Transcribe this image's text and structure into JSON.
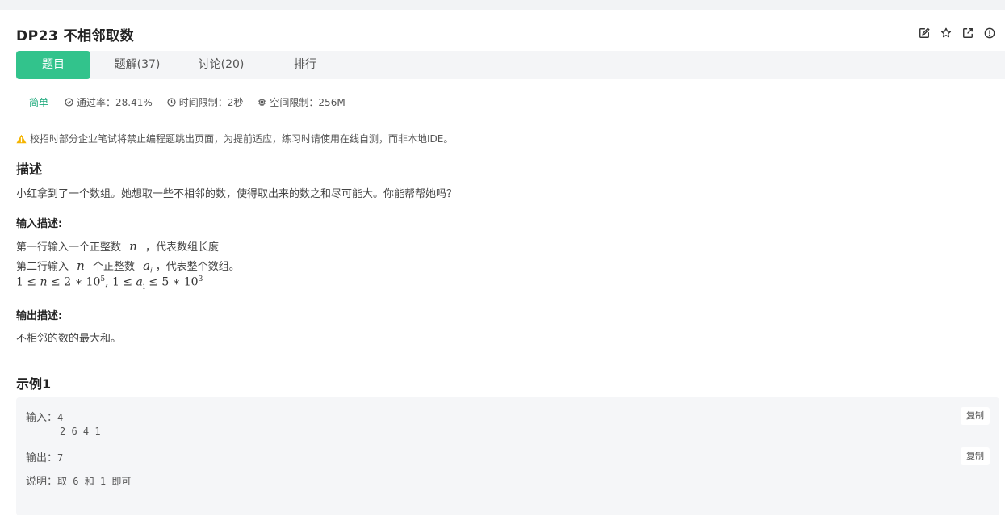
{
  "problem": {
    "title": "DP23  不相邻取数",
    "difficulty": "简单",
    "pass_rate": "通过率：28.41%",
    "time_limit": "时间限制：2秒",
    "space_limit": "空间限制：256M"
  },
  "tabs": [
    {
      "label": "题目",
      "active": true
    },
    {
      "label": "题解(37)"
    },
    {
      "label": "讨论(20)"
    },
    {
      "label": "排行"
    }
  ],
  "top_icons": [
    "edit-icon",
    "star-icon",
    "external-link-icon",
    "info-icon"
  ],
  "warning": "校招时部分企业笔试将禁止编程题跳出页面，为提前适应，练习时请使用在线自测，而非本地IDE。",
  "description": {
    "heading": "描述",
    "text": "小红拿到了一个数组。她想取一些不相邻的数，使得取出来的数之和尽可能大。你能帮帮她吗？"
  },
  "input_desc": {
    "heading": "输入描述:",
    "line1_a": "第一行输入一个正整数",
    "line1_var": "n",
    "line1_b": "，代表数组长度",
    "line2_a": "第二行输入",
    "line2_var": "n",
    "line2_b": "个正整数",
    "line2_var2": "a",
    "line2_sub": "i",
    "line2_c": "，代表整个数组。",
    "constraint_a": "1 ≤ ",
    "constraint_n": "n",
    "constraint_b": " ≤ 2 ∗ 10",
    "constraint_exp1": "5",
    "constraint_c": ", 1 ≤ ",
    "constraint_a_var": "a",
    "constraint_sub": "i",
    "constraint_d": " ≤ 5 ∗ 10",
    "constraint_exp2": "3"
  },
  "output_desc": {
    "heading": "输出描述:",
    "text": "不相邻的数的最大和。"
  },
  "example": {
    "heading": "示例1",
    "input_label": "输入：",
    "input_line1": "4",
    "input_line2": "2 6 4 1",
    "output_label": "输出：",
    "output_value": "7",
    "explain_label": "说明：",
    "explain_value": "取 6 和 1 即可",
    "copy_label": "复制"
  },
  "colors": {
    "accent": "#32c38c",
    "difficulty": "#1aa87a",
    "warning": "#f5b400"
  }
}
